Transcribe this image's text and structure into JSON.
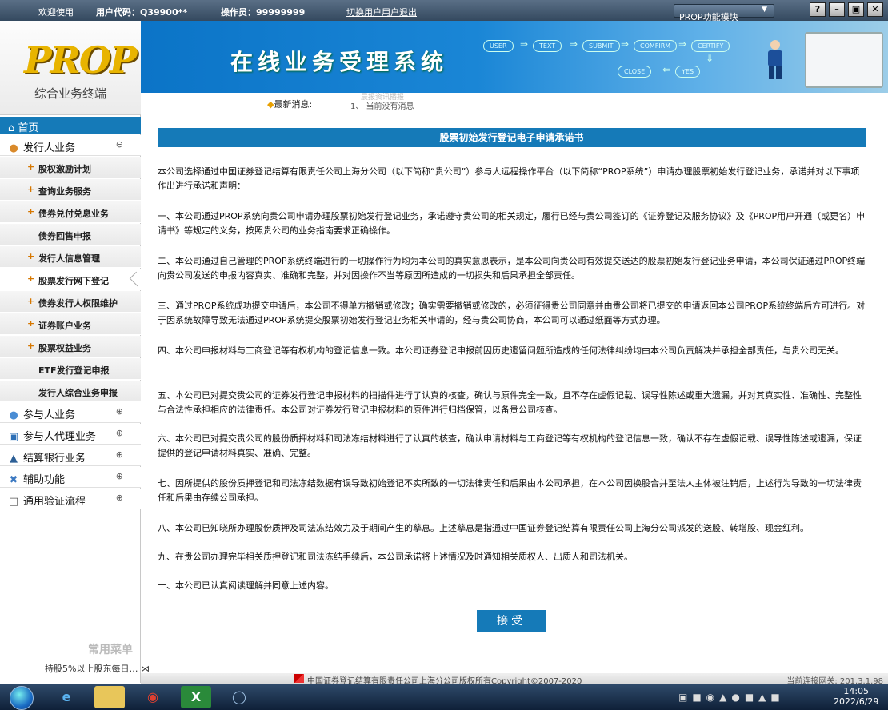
{
  "topbar": {
    "welcome": "欢迎使用",
    "user_code": "用户代码：Q39900**",
    "operator": "操作员：99999999",
    "switch_user": "切换用户",
    "logout": "用户退出",
    "module_select": "PROP功能模块",
    "window_buttons": [
      "?",
      "–",
      "▣",
      "✕"
    ]
  },
  "sidebar": {
    "logo_text": "PROP",
    "logo_subtitle": "综合业务终端",
    "home": "首页",
    "sections": [
      {
        "label": "发行人业务",
        "icon": "person-icon",
        "toggle": "⊖"
      },
      {
        "label": "参与人业务",
        "icon": "people-icon",
        "toggle": "⊕"
      },
      {
        "label": "参与人代理业务",
        "icon": "monitor-icon",
        "toggle": "⊕"
      },
      {
        "label": "结算银行业务",
        "icon": "bank-icon",
        "toggle": "⊕"
      },
      {
        "label": "辅助功能",
        "icon": "tools-icon",
        "toggle": "⊕"
      },
      {
        "label": "通用验证流程",
        "icon": "folder-icon",
        "toggle": "⊕"
      }
    ],
    "issuer_items": [
      {
        "label": "股权激励计划",
        "plus": true
      },
      {
        "label": "查询业务服务",
        "plus": true
      },
      {
        "label": "债券兑付兑息业务",
        "plus": true
      },
      {
        "label": "债券回售申报",
        "plus": false
      },
      {
        "label": "发行人信息管理",
        "plus": true
      },
      {
        "label": "股票发行网下登记",
        "plus": true,
        "selected": true
      },
      {
        "label": "债券发行人权限维护",
        "plus": true
      },
      {
        "label": "证券账户业务",
        "plus": true
      },
      {
        "label": "股票权益业务",
        "plus": true
      },
      {
        "label": "ETF发行登记申报",
        "plus": false
      },
      {
        "label": "发行人综合业务申报",
        "plus": false
      }
    ],
    "common_menu_title": "常用菜单",
    "common_menu_item": "持股5%以上股东每日…"
  },
  "banner": {
    "title": "在线业务受理系统",
    "flow_steps": [
      "USER",
      "TEXT",
      "SUBMIT",
      "COMFIRM",
      "CERTIFY",
      "CLOSE",
      "YES"
    ]
  },
  "news": {
    "label": "最新消息:",
    "top_text": "晨报资讯播报",
    "item": "1、  当前没有消息"
  },
  "content": {
    "title": "股票初始发行登记电子申请承诺书",
    "paragraphs": [
      "本公司选择通过中国证券登记结算有限责任公司上海分公司（以下简称“贵公司”）参与人远程操作平台（以下简称“PROP系统”）申请办理股票初始发行登记业务，承诺并对以下事项作出进行承诺和声明：",
      "一、本公司通过PROP系统向贵公司申请办理股票初始发行登记业务，承诺遵守贵公司的相关规定，履行已经与贵公司签订的《证券登记及服务协议》及《PROP用户开通（或更名）申请书》等规定的义务，按照贵公司的业务指南要求正确操作。",
      "二、本公司通过自己管理的PROP系统终端进行的一切操作行为均为本公司的真实意思表示，是本公司向贵公司有效提交送达的股票初始发行登记业务申请，本公司保证通过PROP终端向贵公司发送的申报内容真实、准确和完整，并对因操作不当等原因所造成的一切损失和后果承担全部责任。",
      "三、通过PROP系统成功提交申请后，本公司不得单方撤销或修改；确实需要撤销或修改的，必须征得贵公司同意并由贵公司将已提交的申请返回本公司PROP系统终端后方可进行。对于因系统故障导致无法通过PROP系统提交股票初始发行登记业务相关申请的，经与贵公司协商，本公司可以通过纸面等方式办理。",
      "四、本公司申报材料与工商登记等有权机构的登记信息一致。本公司证券登记申报前因历史遗留问题所造成的任何法律纠纷均由本公司负责解决并承担全部责任，与贵公司无关。",
      "五、本公司已对提交贵公司的证券发行登记申报材料的扫描件进行了认真的核查，确认与原件完全一致，且不存在虚假记载、误导性陈述或重大遗漏，并对其真实性、准确性、完整性与合法性承担相应的法律责任。本公司对证券发行登记申报材料的原件进行归档保管，以备贵公司核查。",
      "六、本公司已对提交贵公司的股份质押材料和司法冻结材料进行了认真的核查，确认申请材料与工商登记等有权机构的登记信息一致，确认不存在虚假记载、误导性陈述或遗漏，保证提供的登记申请材料真实、准确、完整。",
      "七、因所提供的股份质押登记和司法冻结数据有误导致初始登记不实所致的一切法律责任和后果由本公司承担，在本公司因换股合并至法人主体被注销后，上述行为导致的一切法律责任和后果由存续公司承担。",
      "八、本公司已知晓所办理股份质押及司法冻结效力及于期间产生的孳息。上述孳息是指通过中国证券登记结算有限责任公司上海分公司派发的送股、转增股、现金红利。",
      "九、在贵公司办理完毕相关质押登记和司法冻结手续后，本公司承诺将上述情况及时通知相关质权人、出质人和司法机关。",
      "十、本公司已认真阅读理解并同意上述内容。"
    ],
    "accept_button": "接受"
  },
  "footer": {
    "copyright": "中国证券登记结算有限责任公司上海分公司版权所有Copyright©2007-2020",
    "gateway": "当前连接网关: 201.3.1.98"
  },
  "taskbar": {
    "time": "14:05",
    "date": "2022/6/29"
  },
  "colors": {
    "accent_blue": "#157ab8",
    "topbar_dark": "#34495f",
    "plus_orange": "#d67700"
  }
}
